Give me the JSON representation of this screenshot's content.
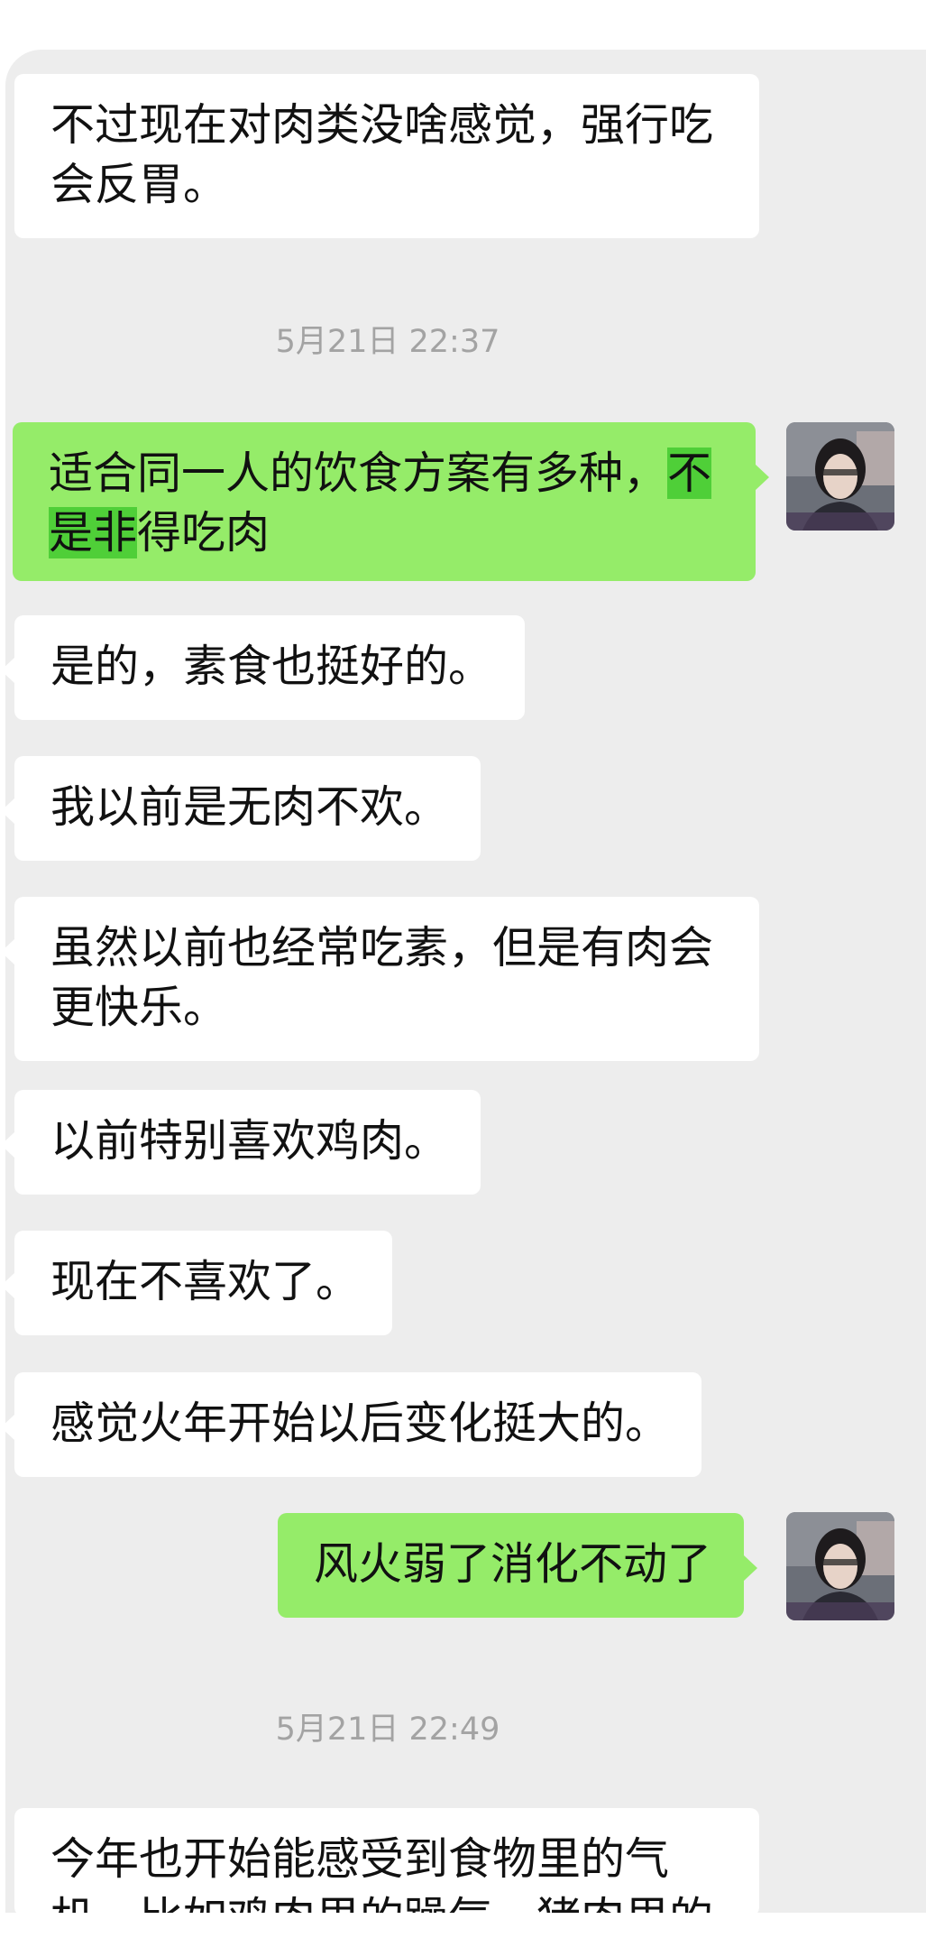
{
  "messages": [
    {
      "text": "不过现在对肉类没啥感觉，强行吃会反胃。"
    },
    {
      "text_a": "适合同一人的饮食方案有多种，",
      "text_hl1": "不",
      "text_hl2": "是非",
      "text_b": "得吃肉"
    },
    {
      "text": "是的，素食也挺好的。"
    },
    {
      "text": "我以前是无肉不欢。"
    },
    {
      "text": "虽然以前也经常吃素，但是有肉会更快乐。"
    },
    {
      "text": "以前特别喜欢鸡肉。"
    },
    {
      "text": "现在不喜欢了。"
    },
    {
      "text": "感觉火年开始以后变化挺大的。"
    },
    {
      "text": "风火弱了消化不动了"
    },
    {
      "text": "今年也开始能感受到食物里的气机，比如鸡肉里的躁气，猪肉里的"
    }
  ],
  "timestamps": [
    "5月21日 22:37",
    "5月21日 22:49"
  ],
  "colors": {
    "incoming": "#ffffff",
    "outgoing": "#95ec69",
    "background": "#ededed",
    "highlight": "#4fcf38"
  },
  "icons": {
    "avatar": "user-avatar-photo"
  }
}
